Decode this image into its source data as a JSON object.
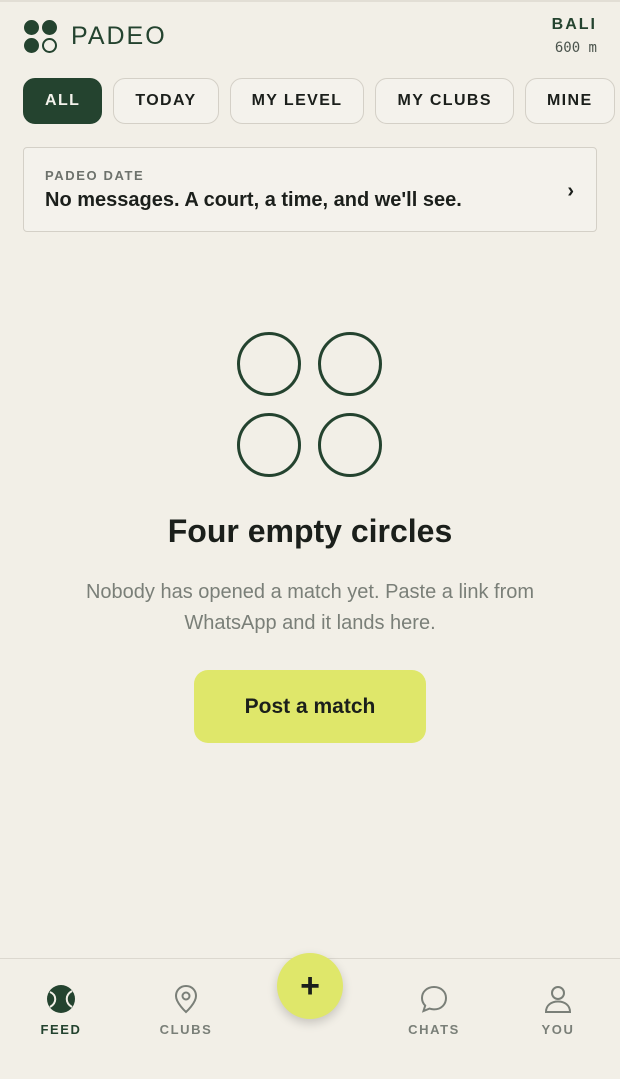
{
  "app": {
    "name": "PADEO"
  },
  "location": {
    "city": "BALI",
    "distance": "600 m"
  },
  "filters": [
    {
      "label": "ALL",
      "active": true
    },
    {
      "label": "TODAY",
      "active": false
    },
    {
      "label": "MY LEVEL",
      "active": false
    },
    {
      "label": "MY CLUBS",
      "active": false
    },
    {
      "label": "MINE",
      "active": false
    }
  ],
  "banner": {
    "eyebrow": "PADEO DATE",
    "message": "No messages. A court, a time, and we'll see.",
    "chevron": "›"
  },
  "empty_state": {
    "title": "Four empty circles",
    "subtitle": "Nobody has opened a match yet. Paste a link from WhatsApp and it lands here.",
    "cta": "Post a match"
  },
  "nav": {
    "items": [
      {
        "label": "FEED",
        "icon": "tennis-ball-icon",
        "active": true
      },
      {
        "label": "CLUBS",
        "icon": "map-pin-icon",
        "active": false
      },
      {
        "label": "CHATS",
        "icon": "chat-bubble-icon",
        "active": false
      },
      {
        "label": "YOU",
        "icon": "user-icon",
        "active": false
      }
    ],
    "fab_label": "+"
  },
  "colors": {
    "background": "#f2efe7",
    "brand_green": "#24432f",
    "accent_lime": "#dfe76a",
    "muted_text": "#7a7f78"
  }
}
